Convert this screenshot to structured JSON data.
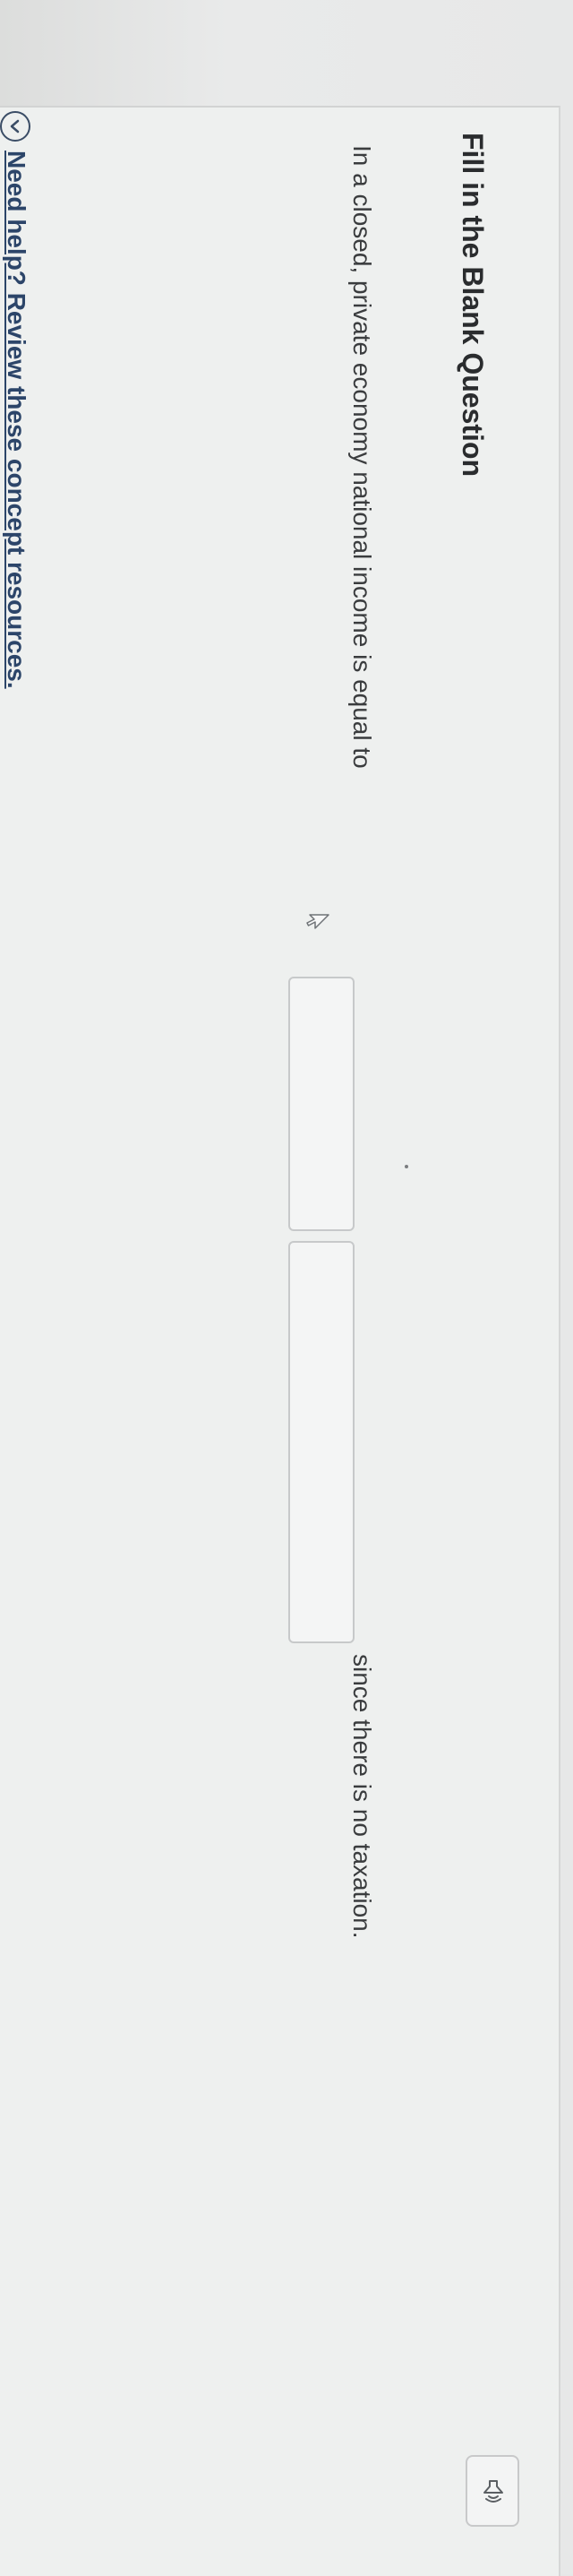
{
  "question": {
    "heading": "Fill in the Blank Question",
    "text_before": "In a closed, private economy national income is equal to",
    "blanks": [
      {
        "value": ""
      },
      {
        "value": ""
      }
    ],
    "text_after": "since there is no taxation."
  },
  "help": {
    "link_text": "Need help? Review these concept resources."
  },
  "toolbar": {
    "read_aloud_icon": "speaker-icon"
  },
  "colors": {
    "link": "#2c4569",
    "heading": "#2a2c2e",
    "body_text": "#3a3c3e",
    "input_border": "#c7c9ca"
  }
}
